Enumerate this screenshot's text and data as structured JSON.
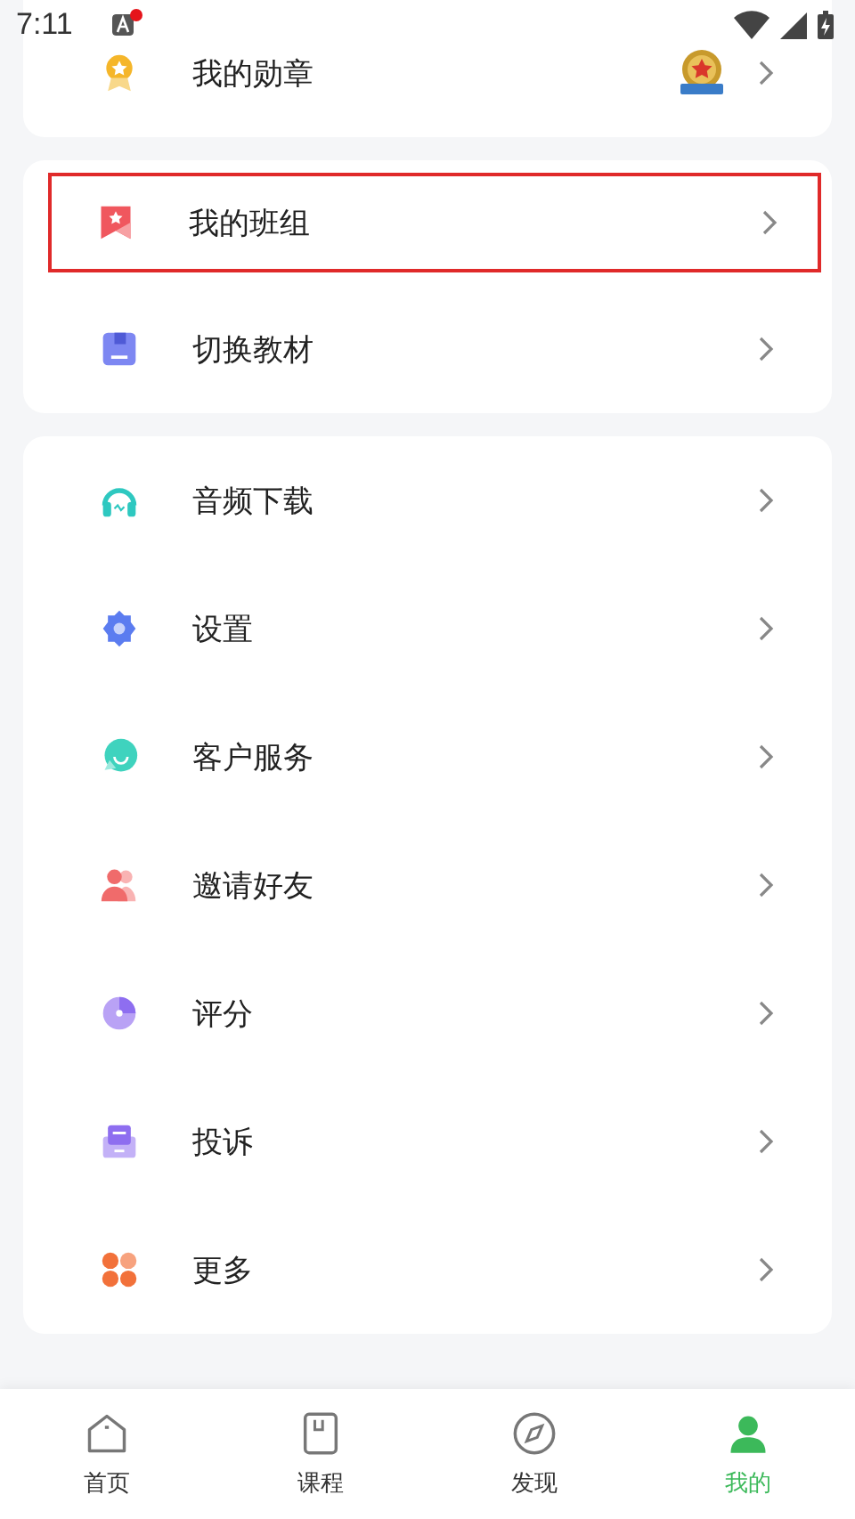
{
  "status_bar": {
    "time": "7:11",
    "notification_dot": true
  },
  "sections": [
    {
      "rows": [
        {
          "label": "我的勋章",
          "badge": true,
          "highlighted": false
        }
      ]
    },
    {
      "rows": [
        {
          "label": "我的班组",
          "badge": false,
          "highlighted": true
        },
        {
          "label": "切换教材",
          "badge": false,
          "highlighted": false
        }
      ]
    },
    {
      "rows": [
        {
          "label": "音频下载",
          "badge": false,
          "highlighted": false
        },
        {
          "label": "设置",
          "badge": false,
          "highlighted": false
        },
        {
          "label": "客户服务",
          "badge": false,
          "highlighted": false
        },
        {
          "label": "邀请好友",
          "badge": false,
          "highlighted": false
        },
        {
          "label": "评分",
          "badge": false,
          "highlighted": false
        },
        {
          "label": "投诉",
          "badge": false,
          "highlighted": false
        },
        {
          "label": "更多",
          "badge": false,
          "highlighted": false
        }
      ]
    }
  ],
  "tabs": [
    {
      "label": "首页",
      "selected": false
    },
    {
      "label": "课程",
      "selected": false
    },
    {
      "label": "发现",
      "selected": false
    },
    {
      "label": "我的",
      "selected": true
    }
  ]
}
